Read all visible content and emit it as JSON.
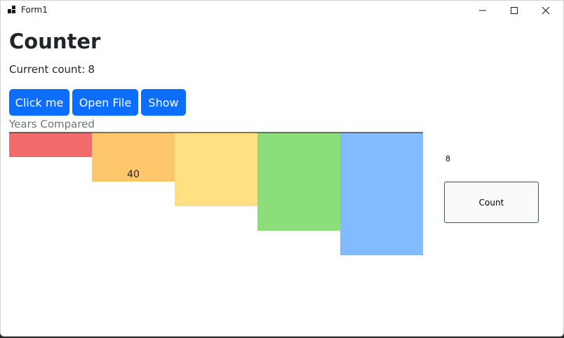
{
  "window": {
    "title": "Form1",
    "controls": [
      "minimize-icon",
      "maximize-icon",
      "close-icon"
    ]
  },
  "page": {
    "heading": "Counter",
    "count_label": "Current count:",
    "count_value": "8"
  },
  "buttons": {
    "click_me": "Click me",
    "open_file": "Open File",
    "show": "Show"
  },
  "colors": {
    "primary": "#0d6efd",
    "caption": "#6c757d"
  },
  "chart_data": {
    "type": "bar",
    "title": "Years Compared",
    "orientation": "downward",
    "categories": [
      "",
      "",
      "",
      "",
      ""
    ],
    "values": [
      20,
      40,
      60,
      80,
      100
    ],
    "colors": [
      "#f26b6b",
      "#ffc76b",
      "#ffe082",
      "#8cde7a",
      "#82bbff"
    ],
    "data_labels": [
      "",
      "40",
      "",
      "",
      ""
    ],
    "ylim": [
      0,
      100
    ],
    "grid": false,
    "legend": "none"
  },
  "side_panel": {
    "count_value": "8",
    "count_button": "Count"
  }
}
